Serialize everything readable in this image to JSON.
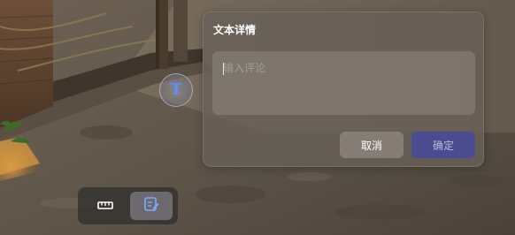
{
  "dialog": {
    "title": "文本详情",
    "comment_placeholder": "输入评论",
    "comment_value": "",
    "cancel_label": "取消",
    "confirm_label": "确定"
  },
  "marker": {
    "glyph": "T",
    "icon": "text-annotation-icon"
  },
  "toolbar": {
    "tools": [
      {
        "icon": "ruler-icon",
        "active": false
      },
      {
        "icon": "edit-note-icon",
        "active": true
      }
    ]
  },
  "colors": {
    "accent": "#4b4b91",
    "marker_glyph": "#5c8fff"
  }
}
